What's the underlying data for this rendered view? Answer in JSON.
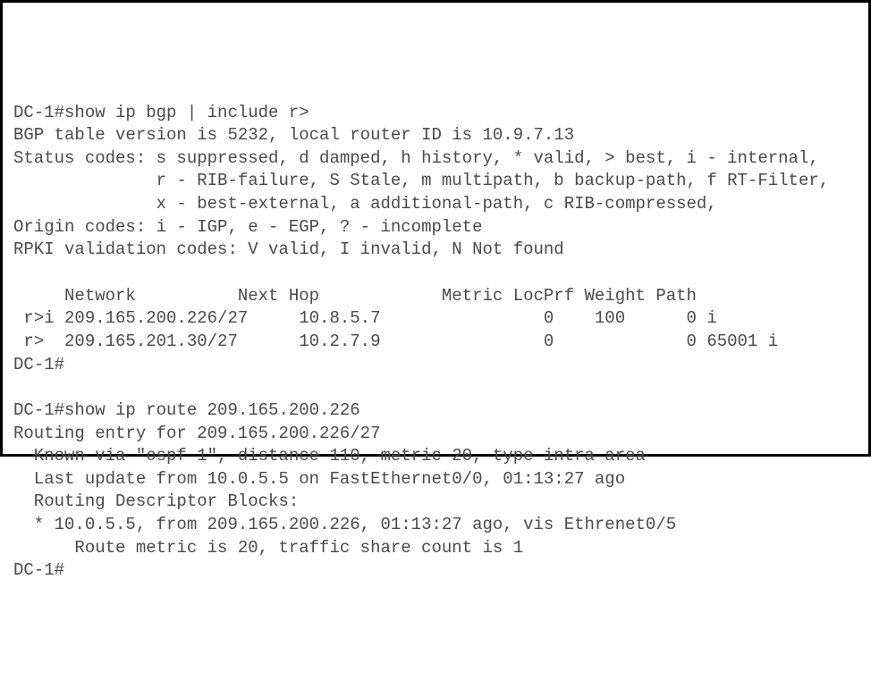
{
  "l01": "DC-1#show ip bgp | include r>",
  "l02": "BGP table version is 5232, local router ID is 10.9.7.13",
  "l03": "Status codes: s suppressed, d damped, h history, * valid, > best, i - internal,",
  "l04": "              r - RIB-failure, S Stale, m multipath, b backup-path, f RT-Filter,",
  "l05": "              x - best-external, a additional-path, c RIB-compressed,",
  "l06": "Origin codes: i - IGP, e - EGP, ? - incomplete",
  "l07": "RPKI validation codes: V valid, I invalid, N Not found",
  "l08": " ",
  "l09": "     Network          Next Hop            Metric LocPrf Weight Path",
  "l10": " r>i 209.165.200.226/27     10.8.5.7                0    100      0 i",
  "l11": " r>  209.165.201.30/27      10.2.7.9                0             0 65001 i",
  "l12": "DC-1#",
  "l13": " ",
  "l14": "DC-1#show ip route 209.165.200.226",
  "l15": "Routing entry for 209.165.200.226/27",
  "l16": "  Known via \"ospf 1\", distance 110, metric 20, type intra area",
  "l17": "  Last update from 10.0.5.5 on FastEthernet0/0, 01:13:27 ago",
  "l18": "  Routing Descriptor Blocks:",
  "l19": "  * 10.0.5.5, from 209.165.200.226, 01:13:27 ago, vis Ethrenet0/5",
  "l20": "      Route metric is 20, traffic share count is 1",
  "l21": "DC-1#"
}
